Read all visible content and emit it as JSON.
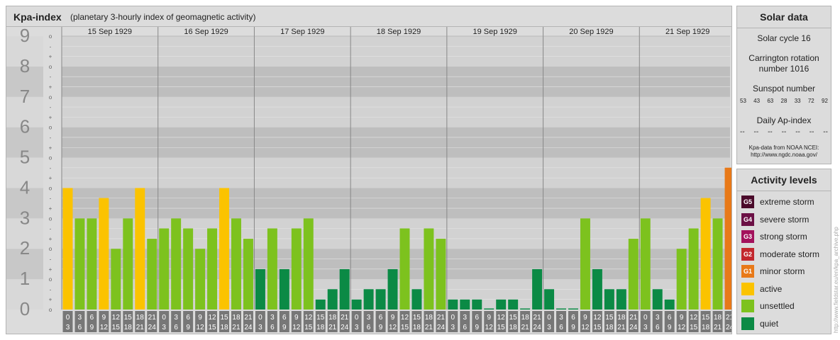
{
  "chart_data": {
    "type": "bar",
    "title": "Kpa-index",
    "subtitle": "(planetary 3-hourly index of geomagnetic activity)",
    "ylim": [
      0,
      9
    ],
    "y_tick_labels": [
      "0",
      "1",
      "2",
      "3",
      "4",
      "5",
      "6",
      "7",
      "8",
      "9"
    ],
    "minor_tick_labels": [
      "o",
      "+",
      "-"
    ],
    "days": [
      "15 Sep 1929",
      "16 Sep 1929",
      "17 Sep 1929",
      "18 Sep 1929",
      "19 Sep 1929",
      "20 Sep 1929",
      "21 Sep 1929"
    ],
    "interval_start_labels": [
      "0",
      "3",
      "6",
      "9",
      "12",
      "15",
      "18",
      "21"
    ],
    "interval_end_labels": [
      "3",
      "6",
      "9",
      "12",
      "15",
      "18",
      "21",
      "24"
    ],
    "values": [
      4.0,
      3.0,
      3.0,
      3.67,
      2.0,
      3.0,
      4.0,
      2.33,
      2.67,
      3.0,
      2.67,
      2.0,
      2.67,
      4.0,
      3.0,
      2.33,
      1.33,
      2.67,
      1.33,
      2.67,
      3.0,
      0.33,
      0.67,
      1.33,
      0.33,
      0.67,
      0.67,
      1.33,
      2.67,
      0.67,
      2.67,
      2.33,
      0.33,
      0.33,
      0.33,
      0.0,
      0.33,
      0.33,
      0.0,
      1.33,
      0.67,
      0.0,
      0.0,
      3.0,
      1.33,
      0.67,
      0.67,
      2.33,
      3.0,
      0.67,
      0.33,
      2.0,
      2.67,
      3.67,
      3.0,
      4.67
    ],
    "colors": {
      "quiet": "#0b8a45",
      "unsettled": "#7dc21e",
      "active": "#fbc300",
      "minor_storm": "#e87918",
      "moderate_storm": "#c2272d",
      "strong_storm": "#a3125c",
      "severe_storm": "#6b1045",
      "extreme_storm": "#4a0a2a"
    }
  },
  "solar": {
    "title": "Solar data",
    "cycle": "Solar cycle 16",
    "carrington_line1": "Carrington rotation",
    "carrington_line2": "number 1016",
    "sunspot_label": "Sunspot number",
    "sunspots": [
      "53",
      "43",
      "63",
      "28",
      "33",
      "72",
      "92"
    ],
    "ap_label": "Daily Ap-index",
    "ap_values": [
      "--",
      "--",
      "--",
      "--",
      "--",
      "--",
      "--"
    ],
    "source_line1": "Kpa-data from NOAA NCEI:",
    "source_line2": "http://www.ngdc.noaa.gov/"
  },
  "levels": {
    "title": "Activity levels",
    "items": [
      {
        "badge": "G5",
        "label": "extreme storm",
        "color": "#4a0a2a"
      },
      {
        "badge": "G4",
        "label": "severe storm",
        "color": "#6b1045"
      },
      {
        "badge": "G3",
        "label": "strong storm",
        "color": "#a3125c"
      },
      {
        "badge": "G2",
        "label": "moderate storm",
        "color": "#c2272d"
      },
      {
        "badge": "G1",
        "label": "minor storm",
        "color": "#e87918"
      },
      {
        "badge": "",
        "label": "active",
        "color": "#fbc300"
      },
      {
        "badge": "",
        "label": "unsettled",
        "color": "#7dc21e"
      },
      {
        "badge": "",
        "label": "quiet",
        "color": "#0b8a45"
      }
    ]
  },
  "watermark": "http://www.fieldstar.eu/en/kpa_archive.php"
}
